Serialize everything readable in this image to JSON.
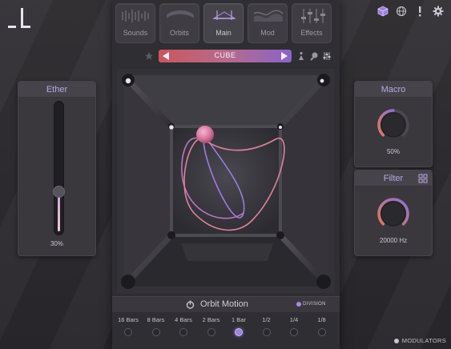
{
  "tabs": [
    {
      "label": "Sounds",
      "active": false
    },
    {
      "label": "Orbits",
      "active": false
    },
    {
      "label": "Main",
      "active": true
    },
    {
      "label": "Mod",
      "active": false
    },
    {
      "label": "Effects",
      "active": false
    }
  ],
  "preset": {
    "name": "CUBE"
  },
  "ether": {
    "title": "Ether",
    "value_text": "30%",
    "value": 0.3
  },
  "macro": {
    "title": "Macro",
    "value_text": "50%",
    "value": 0.5
  },
  "filter": {
    "title": "Filter",
    "value_text": "20000 Hz",
    "value": 1.0
  },
  "orbit_motion": {
    "title": "Orbit Motion",
    "division_label": "DIVISION",
    "divisions": [
      "16 Bars",
      "8 Bars",
      "4 Bars",
      "2 Bars",
      "1 Bar",
      "1/2",
      "1/4",
      "1/8"
    ],
    "selected_index": 4
  },
  "modulators_label": "MODULATORS",
  "colors": {
    "accent_purple": "#a68ae0",
    "preset_gradient_start": "#c8575e",
    "preset_gradient_end": "#8a63c9",
    "orbit_pink": "#d97aa0",
    "orbit_purple": "#9d7be0",
    "knob_orange": "#e07a58",
    "knob_purple": "#8f6fd6"
  }
}
